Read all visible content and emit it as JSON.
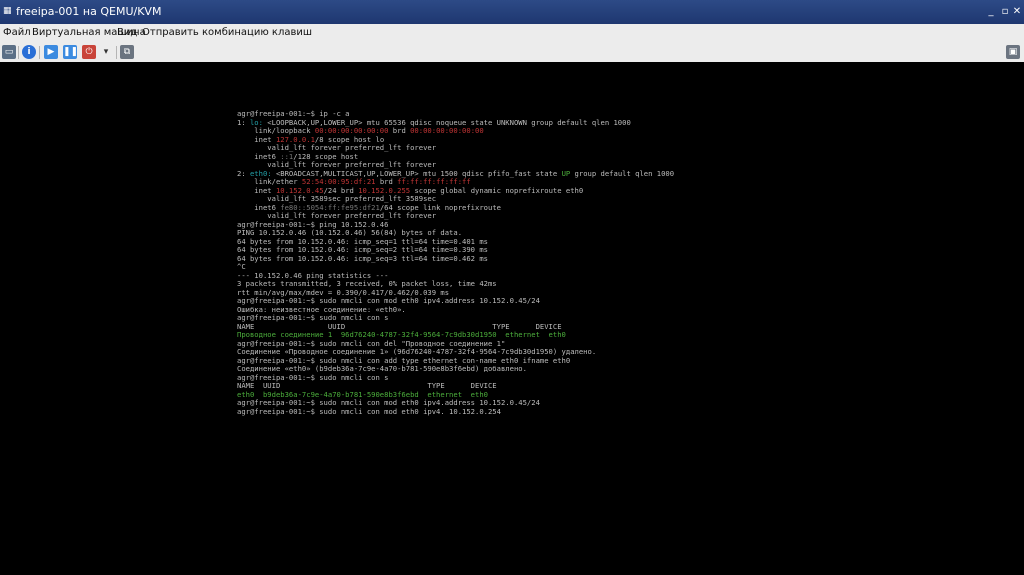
{
  "window": {
    "title": "freeipa-001 на QEMU/KVM",
    "controls": {
      "minimize": "_",
      "maximize": "▫",
      "close": "✕"
    }
  },
  "menu": {
    "items": [
      "Файл",
      "Виртуальная машина",
      "Вид",
      "Отправить комбинацию клавиш"
    ]
  },
  "toolbar": {
    "icons": [
      "monitor-icon",
      "info-icon",
      "play-icon",
      "pause-icon",
      "power-icon",
      "dropdown-icon",
      "snapshot-icon",
      "fullscreen-icon"
    ],
    "colors": {
      "info": "#2a6fd6",
      "play": "#3c8be0",
      "pause": "#3c8be0",
      "power": "#c9443a"
    }
  },
  "terminal": {
    "lines": [
      [
        {
          "t": "agr@freeipa-001:~$ ip -c a"
        }
      ],
      [
        {
          "t": "1: "
        },
        {
          "t": "lo:",
          "c": "cyan"
        },
        {
          "t": " <LOOPBACK,UP,LOWER_UP> mtu 65536 qdisc noqueue state UNKNOWN group default qlen 1000"
        }
      ],
      [
        {
          "t": "    link/loopback "
        },
        {
          "t": "00:00:00:00:00:00",
          "c": "red"
        },
        {
          "t": " brd "
        },
        {
          "t": "00:00:00:00:00:00",
          "c": "red"
        }
      ],
      [
        {
          "t": "    inet "
        },
        {
          "t": "127.0.0.1",
          "c": "red"
        },
        {
          "t": "/8 scope host lo"
        }
      ],
      [
        {
          "t": "       valid_lft forever preferred_lft forever"
        }
      ],
      [
        {
          "t": "    inet6 "
        },
        {
          "t": "::1",
          "c": "dim"
        },
        {
          "t": "/128 scope host"
        }
      ],
      [
        {
          "t": "       valid_lft forever preferred_lft forever"
        }
      ],
      [
        {
          "t": "2: "
        },
        {
          "t": "eth0:",
          "c": "cyan"
        },
        {
          "t": " <BROADCAST,MULTICAST,UP,LOWER_UP> mtu 1500 qdisc pfifo_fast state "
        },
        {
          "t": "UP",
          "c": "green"
        },
        {
          "t": " group default qlen 1000"
        }
      ],
      [
        {
          "t": "    link/ether "
        },
        {
          "t": "52:54:00:95:df:21",
          "c": "red"
        },
        {
          "t": " brd "
        },
        {
          "t": "ff:ff:ff:ff:ff:ff",
          "c": "red"
        }
      ],
      [
        {
          "t": "    inet "
        },
        {
          "t": "10.152.0.45",
          "c": "red"
        },
        {
          "t": "/24 brd "
        },
        {
          "t": "10.152.0.255",
          "c": "red"
        },
        {
          "t": " scope global dynamic noprefixroute eth0"
        }
      ],
      [
        {
          "t": "       valid_lft 3589sec preferred_lft 3589sec"
        }
      ],
      [
        {
          "t": "    inet6 "
        },
        {
          "t": "fe80::5054:ff:fe95:df21",
          "c": "dim"
        },
        {
          "t": "/64 scope link noprefixroute"
        }
      ],
      [
        {
          "t": "       valid_lft forever preferred_lft forever"
        }
      ],
      [
        {
          "t": "agr@freeipa-001:~$ ping 10.152.0.46"
        }
      ],
      [
        {
          "t": "PING 10.152.0.46 (10.152.0.46) 56(84) bytes of data."
        }
      ],
      [
        {
          "t": "64 bytes from 10.152.0.46: icmp_seq=1 ttl=64 time=0.401 ms"
        }
      ],
      [
        {
          "t": "64 bytes from 10.152.0.46: icmp_seq=2 ttl=64 time=0.390 ms"
        }
      ],
      [
        {
          "t": "64 bytes from 10.152.0.46: icmp_seq=3 ttl=64 time=0.462 ms"
        }
      ],
      [
        {
          "t": "^C"
        }
      ],
      [
        {
          "t": "--- 10.152.0.46 ping statistics ---"
        }
      ],
      [
        {
          "t": "3 packets transmitted, 3 received, 0% packet loss, time 42ms"
        }
      ],
      [
        {
          "t": "rtt min/avg/max/mdev = 0.390/0.417/0.462/0.039 ms"
        }
      ],
      [
        {
          "t": "agr@freeipa-001:~$ sudo nmcli con mod eth0 ipv4.address 10.152.0.45/24"
        }
      ],
      [
        {
          "t": "Ошибка: неизвестное соединение: «eth0»."
        }
      ],
      [
        {
          "t": "agr@freeipa-001:~$ sudo nmcli con s"
        }
      ],
      [
        {
          "t": "NAME                 UUID                                  TYPE      DEVICE"
        }
      ],
      [
        {
          "t": "Проводное соединение 1  96d76240-4787-32f4-9564-7c9db30d1950  ethernet  eth0",
          "c": "green"
        }
      ],
      [
        {
          "t": "agr@freeipa-001:~$ sudo nmcli con del \"Проводное соединение 1\""
        }
      ],
      [
        {
          "t": "Соединение «Проводное соединение 1» (96d76240-4787-32f4-9564-7c9db30d1950) удалено."
        }
      ],
      [
        {
          "t": "agr@freeipa-001:~$ sudo nmcli con add type ethernet con-name eth0 ifname eth0"
        }
      ],
      [
        {
          "t": "Соединение «eth0» (b9deb36a-7c9e-4a70-b781-590e8b3f6ebd) добавлено."
        }
      ],
      [
        {
          "t": "agr@freeipa-001:~$ sudo nmcli con s"
        }
      ],
      [
        {
          "t": "NAME  UUID                                  TYPE      DEVICE"
        }
      ],
      [
        {
          "t": "eth0  b9deb36a-7c9e-4a70-b781-590e8b3f6ebd  ethernet  eth0",
          "c": "green"
        }
      ],
      [
        {
          "t": "agr@freeipa-001:~$ sudo nmcli con mod eth0 ipv4.address 10.152.0.45/24"
        }
      ],
      [
        {
          "t": "agr@freeipa-001:~$ sudo nmcli con mod eth0 ipv4. 10.152.0.254"
        }
      ]
    ]
  }
}
